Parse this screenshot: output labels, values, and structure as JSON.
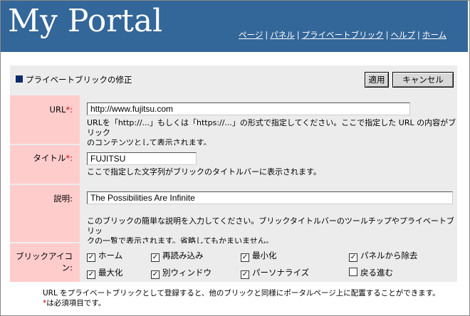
{
  "header": {
    "title": "My Portal",
    "nav": [
      "ページ",
      "パネル",
      "プライベートブリック",
      "ヘルプ",
      "ホーム"
    ],
    "bg_color": "#336699"
  },
  "panel": {
    "title": "プライベートブリックの修正",
    "apply_label": "適用",
    "cancel_label": "キャンセル"
  },
  "form": {
    "url": {
      "label": "URL",
      "required_mark": "*:",
      "value": "http://www.fujitsu.com",
      "help_line1": "URLを「http://...」もしくは「https://...」の形式で指定してください。ここで指定した URL の内容がブリック",
      "help_line2": "のコンテンツとして表示されます。"
    },
    "title": {
      "label": "タイトル",
      "required_mark": "*:",
      "value": "FUJITSU",
      "help": "ここで指定した文字列がブリックのタイトルバーに表示されます。"
    },
    "description": {
      "label": "説明:",
      "value": "The Possibilities Are Infinite",
      "help_line1": "このブリックの簡単な説明を入力してください。ブリックタイトルバーのツールチップやプライベートブリッ",
      "help_line2": "クの一覧で表示されます。省略してもかまいません。"
    },
    "icons": {
      "label": "ブリックアイコン:",
      "options": [
        {
          "label": "ホーム",
          "checked": true
        },
        {
          "label": "再読み込み",
          "checked": true
        },
        {
          "label": "最小化",
          "checked": true
        },
        {
          "label": "パネルから除去",
          "checked": true
        },
        {
          "label": "最大化",
          "checked": true
        },
        {
          "label": "別ウィンドウ",
          "checked": true
        },
        {
          "label": "パーソナライズ",
          "checked": true
        },
        {
          "label": "戻る進む",
          "checked": false
        }
      ]
    }
  },
  "footer": {
    "line1": "URL をプライベートブリックとして登録すると、他のブリックと同様にポータルページ上に配置することができます。",
    "star": "*",
    "line2": "は必須項目です。"
  }
}
